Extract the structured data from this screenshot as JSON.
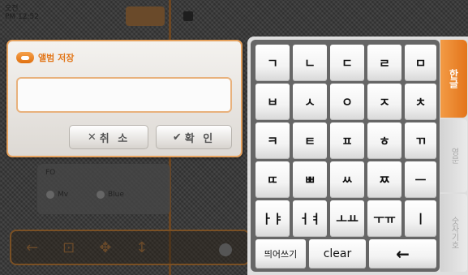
{
  "background": {
    "time_line1": "오전",
    "time_line2": "PM 12:52",
    "panel_label": "FO",
    "radio1": "Mv",
    "radio2": "Blue",
    "toolbar_icons": [
      "←",
      "⊡",
      "✥",
      "↕"
    ]
  },
  "dialog": {
    "title": "앨범 저장",
    "name_value": "",
    "cancel_icon": "✕",
    "cancel_label": "취 소",
    "ok_icon": "✔",
    "ok_label": "확 인"
  },
  "keyboard": {
    "rows": [
      [
        "ㄱ",
        "ㄴ",
        "ㄷ",
        "ㄹ",
        "ㅁ"
      ],
      [
        "ㅂ",
        "ㅅ",
        "ㅇ",
        "ㅈ",
        "ㅊ"
      ],
      [
        "ㅋ",
        "ㅌ",
        "ㅍ",
        "ㅎ",
        "ㄲ"
      ],
      [
        "ㄸ",
        "ㅃ",
        "ㅆ",
        "ㅉ",
        "ㅡ"
      ],
      [
        "ㅏㅑ",
        "ㅓㅕ",
        "ㅗㅛ",
        "ㅜㅠ",
        "ㅣ"
      ]
    ],
    "space_label": "띄어쓰기",
    "clear_label": "clear",
    "backspace_icon": "←",
    "tabs": [
      "한글",
      "영문",
      "숫자기호"
    ],
    "active_tab": "한글",
    "accent": "#e8801f"
  }
}
